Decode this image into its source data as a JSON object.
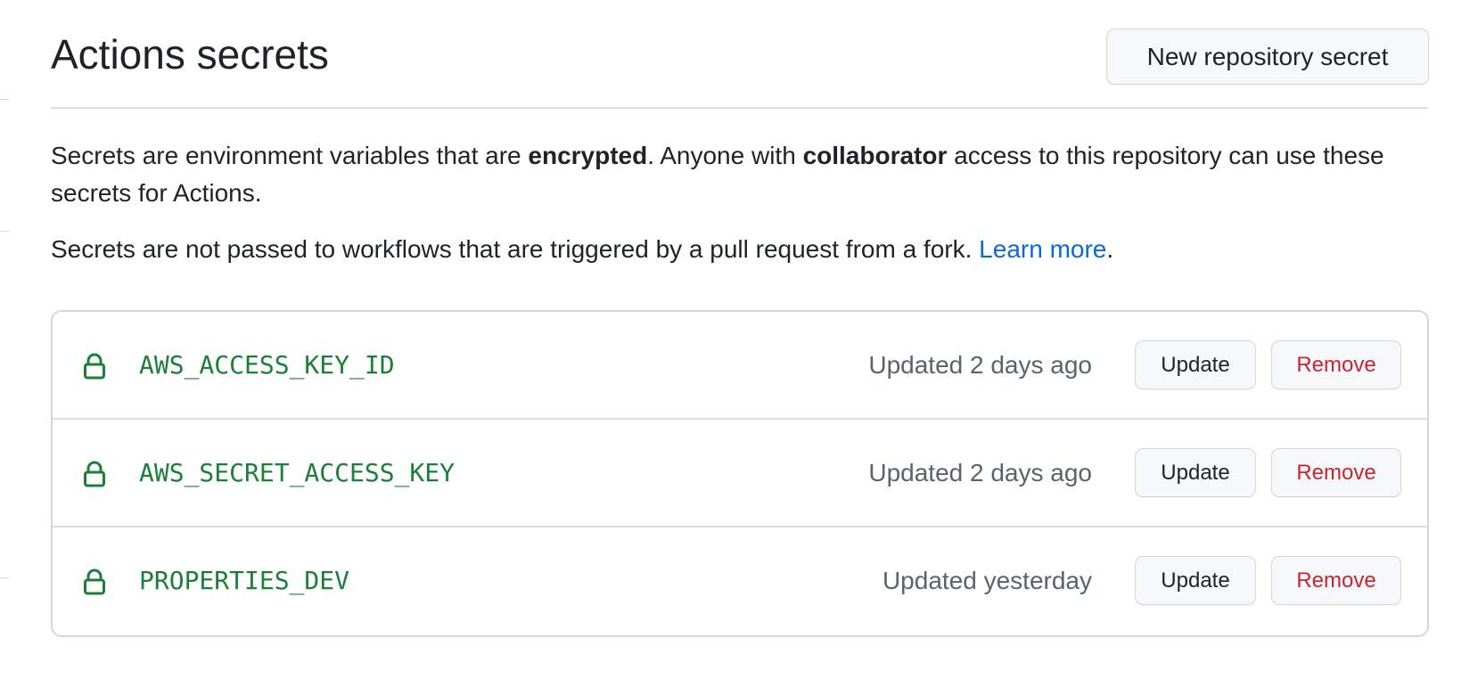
{
  "page": {
    "title": "Actions secrets",
    "new_secret_button": "New repository secret"
  },
  "description": {
    "paragraph1": {
      "part1": "Secrets are environment variables that are ",
      "bold1": "encrypted",
      "part2": ". Anyone with ",
      "bold2": "collaborator",
      "part3": " access to this repository can use these secrets for Actions."
    },
    "paragraph2": {
      "text": "Secrets are not passed to workflows that are triggered by a pull request from a fork. ",
      "link": "Learn more",
      "end": "."
    }
  },
  "secrets": [
    {
      "name": "AWS_ACCESS_KEY_ID",
      "updated": "Updated 2 days ago",
      "update_label": "Update",
      "remove_label": "Remove",
      "icon": "lock-icon"
    },
    {
      "name": "AWS_SECRET_ACCESS_KEY",
      "updated": "Updated 2 days ago",
      "update_label": "Update",
      "remove_label": "Remove",
      "icon": "lock-icon"
    },
    {
      "name": "PROPERTIES_DEV",
      "updated": "Updated yesterday",
      "update_label": "Update",
      "remove_label": "Remove",
      "icon": "lock-icon"
    }
  ],
  "colors": {
    "secret_name": "#1a7f37",
    "link": "#0969da",
    "remove": "#cf222e",
    "muted": "#59636e",
    "border": "#d0d7de"
  }
}
